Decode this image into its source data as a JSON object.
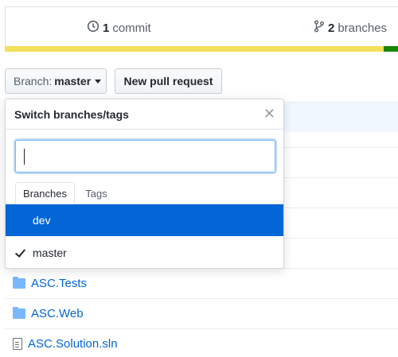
{
  "stats": {
    "commits_count": "1",
    "commits_label": "commit",
    "branches_count": "2",
    "branches_label": "branches"
  },
  "language_bar": {
    "colors": [
      "#f1e05a",
      "#178600"
    ]
  },
  "toolbar": {
    "branch_label": "Branch:",
    "branch_value": "master",
    "new_pr_label": "New pull request"
  },
  "branch_dropdown": {
    "title": "Switch branches/tags",
    "filter_value": "",
    "tabs": [
      "Branches",
      "Tags"
    ],
    "active_tab": "Branches",
    "items": [
      {
        "name": "dev",
        "selected": true,
        "current": false
      },
      {
        "name": "master",
        "selected": false,
        "current": true
      }
    ],
    "accent": "#0366d6"
  },
  "files": [
    {
      "name": "ASC.Tests",
      "type": "folder"
    },
    {
      "name": "ASC.Web",
      "type": "folder"
    },
    {
      "name": "ASC.Solution.sln",
      "type": "file"
    }
  ],
  "icons": {
    "commits": "history-icon",
    "branches": "git-branch-icon",
    "close": "close-icon",
    "check": "check-icon",
    "folder": "folder-icon",
    "file": "file-icon"
  }
}
